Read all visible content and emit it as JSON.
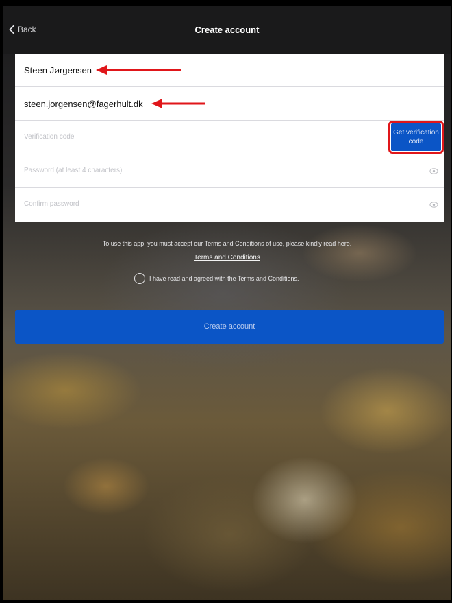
{
  "navbar": {
    "back_label": "Back",
    "title": "Create account"
  },
  "form": {
    "name_value": "Steen Jørgensen",
    "email_value": "steen.jorgensen@fagerhult.dk",
    "verification_placeholder": "Verification code",
    "verification_button": "Get verification code",
    "password_placeholder": "Password (at least 4 characters)",
    "confirm_placeholder": "Confirm password"
  },
  "terms": {
    "notice": "To use this app, you must accept our Terms and Conditions of use, please kindly read here.",
    "link_label": "Terms and Conditions",
    "agree_label": "I have read and agreed with the Terms and Conditions."
  },
  "create_button": "Create account",
  "colors": {
    "primary": "#0b55c6",
    "highlight": "#e0161a"
  },
  "icons": {
    "back": "chevron-left-icon",
    "eye": "eye-icon",
    "annotation": "arrow-left-icon"
  }
}
